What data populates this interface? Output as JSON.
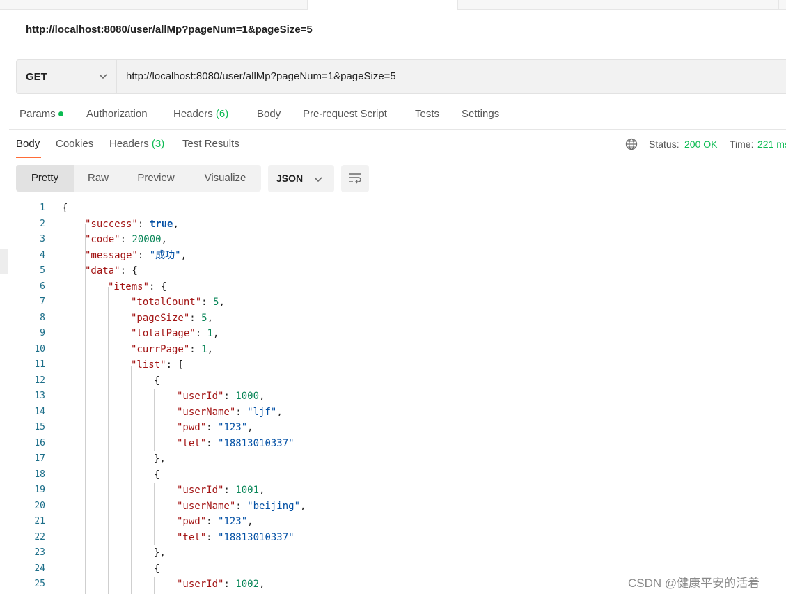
{
  "request": {
    "title": "http://localhost:8080/user/allMp?pageNum=1&pageSize=5",
    "method": "GET",
    "url": "http://localhost:8080/user/allMp?pageNum=1&pageSize=5",
    "tabs": {
      "params": "Params",
      "authorization": "Authorization",
      "headers": "Headers",
      "headers_count": "(6)",
      "body": "Body",
      "prerequest": "Pre-request Script",
      "tests": "Tests",
      "settings": "Settings"
    }
  },
  "response": {
    "tabs": {
      "body": "Body",
      "cookies": "Cookies",
      "headers": "Headers",
      "headers_count": "(3)",
      "test_results": "Test Results"
    },
    "status_label": "Status:",
    "status_value": "200 OK",
    "time_label": "Time:",
    "time_value": "221 ms",
    "views": [
      "Pretty",
      "Raw",
      "Preview",
      "Visualize"
    ],
    "selected_view": "Pretty",
    "format": "JSON"
  },
  "code_lines": [
    "1",
    "2",
    "3",
    "4",
    "5",
    "6",
    "7",
    "8",
    "9",
    "10",
    "11",
    "12",
    "13",
    "14",
    "15",
    "16",
    "17",
    "18",
    "19",
    "20",
    "21",
    "22",
    "23",
    "24",
    "25"
  ],
  "json": {
    "success_key": "\"success\"",
    "success_val": "true",
    "code_key": "\"code\"",
    "code_val": "20000",
    "message_key": "\"message\"",
    "message_val": "\"成功\"",
    "data_key": "\"data\"",
    "items_key": "\"items\"",
    "totalCount_key": "\"totalCount\"",
    "totalCount_val": "5",
    "pageSize_key": "\"pageSize\"",
    "pageSize_val": "5",
    "totalPage_key": "\"totalPage\"",
    "totalPage_val": "1",
    "currPage_key": "\"currPage\"",
    "currPage_val": "1",
    "list_key": "\"list\"",
    "userId_key": "\"userId\"",
    "userName_key": "\"userName\"",
    "pwd_key": "\"pwd\"",
    "tel_key": "\"tel\"",
    "u1_id": "1000",
    "u1_name": "\"ljf\"",
    "u1_pwd": "\"123\"",
    "u1_tel": "\"18813010337\"",
    "u2_id": "1001",
    "u2_name": "\"beijing\"",
    "u2_pwd": "\"123\"",
    "u2_tel": "\"18813010337\"",
    "u3_id": "1002"
  },
  "watermark": "CSDN @健康平安的活着",
  "icons": {
    "method_dropdown": "chevron-down-icon",
    "format_dropdown": "chevron-down-icon",
    "wrap": "wrap-lines-icon",
    "network": "globe-icon"
  }
}
